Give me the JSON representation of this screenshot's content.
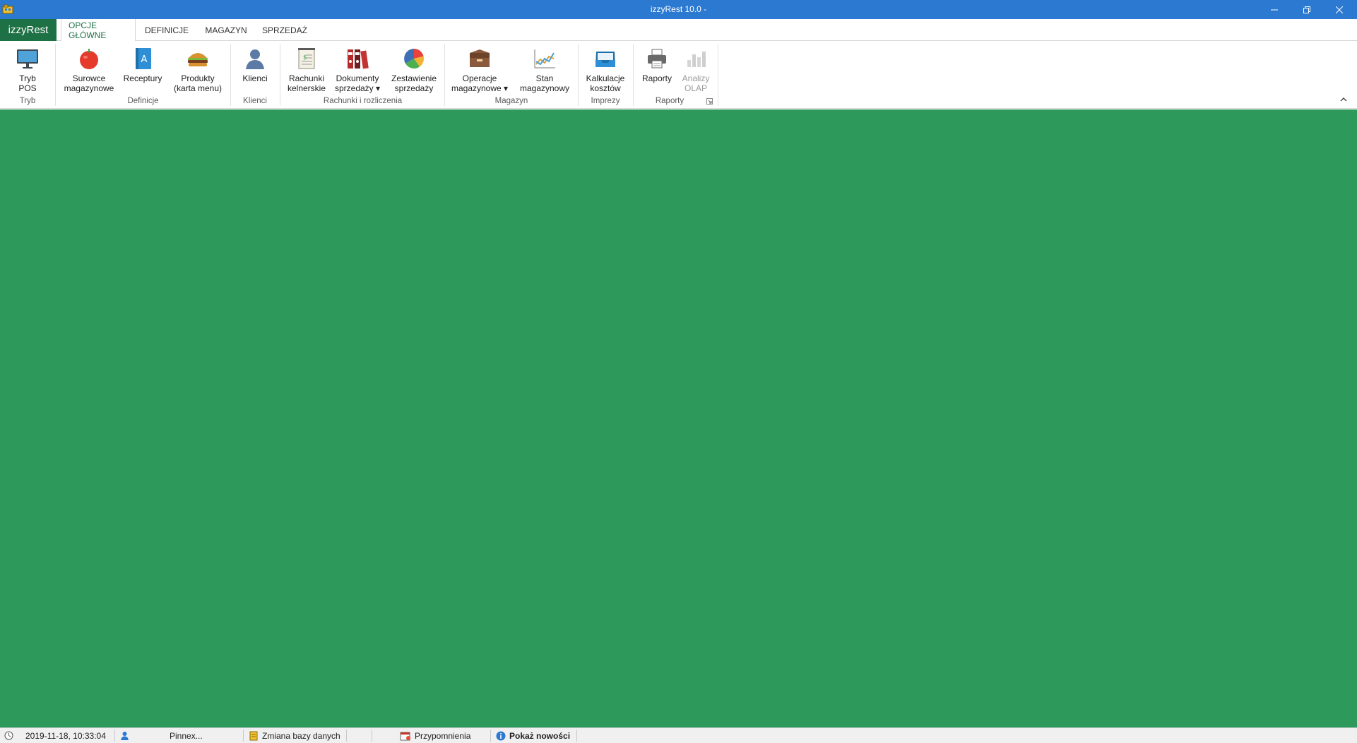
{
  "window": {
    "title": "izzyRest 10.0 -",
    "app_icon": "izzyrest-app-icon",
    "controls": [
      "minimize-icon",
      "restore-icon",
      "close-icon"
    ]
  },
  "ribbon_tabs": {
    "file": "izzyRest",
    "tabs": [
      "OPCJE GŁÓWNE",
      "DEFINICJE",
      "MAGAZYN",
      "SPRZEDAŻ"
    ],
    "active": "OPCJE GŁÓWNE"
  },
  "ribbon": {
    "buttons": {
      "tryb_pos": [
        "Tryb",
        "POS"
      ],
      "surowce": [
        "Surowce",
        "magazynowe"
      ],
      "receptury": [
        "Receptury"
      ],
      "produkty": [
        "Produkty",
        "(karta menu)"
      ],
      "klienci": [
        "Klienci"
      ],
      "rachunki": [
        "Rachunki",
        "kelnerskie"
      ],
      "dokumenty": [
        "Dokumenty",
        "sprzedaży ▾"
      ],
      "zestawienie": [
        "Zestawienie",
        "sprzedaży"
      ],
      "operacje": [
        "Operacje",
        "magazynowe ▾"
      ],
      "stan": [
        "Stan",
        "magazynowy"
      ],
      "kalkulacje": [
        "Kalkulacje",
        "kosztów"
      ],
      "raporty": [
        "Raporty"
      ],
      "analizy": [
        "Analizy",
        "OLAP"
      ]
    },
    "groups": {
      "tryb": "Tryb",
      "definicje": "Definicje",
      "klienci": "Klienci",
      "rachunki": "Rachunki i rozliczenia",
      "magazyn": "Magazyn",
      "imprezy": "Imprezy",
      "raporty": "Raporty"
    },
    "icons": {
      "tryb_pos": "monitor-icon",
      "surowce": "tomato-icon",
      "receptury": "recipe-book-icon",
      "produkty": "burger-icon",
      "klienci": "person-icon",
      "rachunki": "receipt-icon",
      "dokumenty": "binders-icon",
      "zestawienie": "pie-chart-icon",
      "operacje": "box-icon",
      "stan": "line-chart-icon",
      "kalkulacje": "inbox-tray-icon",
      "raporty": "printer-icon",
      "analizy": "bar-chart-icon"
    },
    "disabled": [
      "analizy"
    ]
  },
  "main": {
    "background_color": "#2d9a5c"
  },
  "statusbar": {
    "datetime": "2019-11-18, 10:33:04",
    "user": "Pinnex...",
    "change_db": "Zmiana bazy danych",
    "reminders": "Przypomnienia",
    "news": "Pokaż nowości"
  },
  "colors": {
    "titlebar": "#2b79d0",
    "file_tab": "#1e7145",
    "active_tab_text": "#1e7145"
  }
}
